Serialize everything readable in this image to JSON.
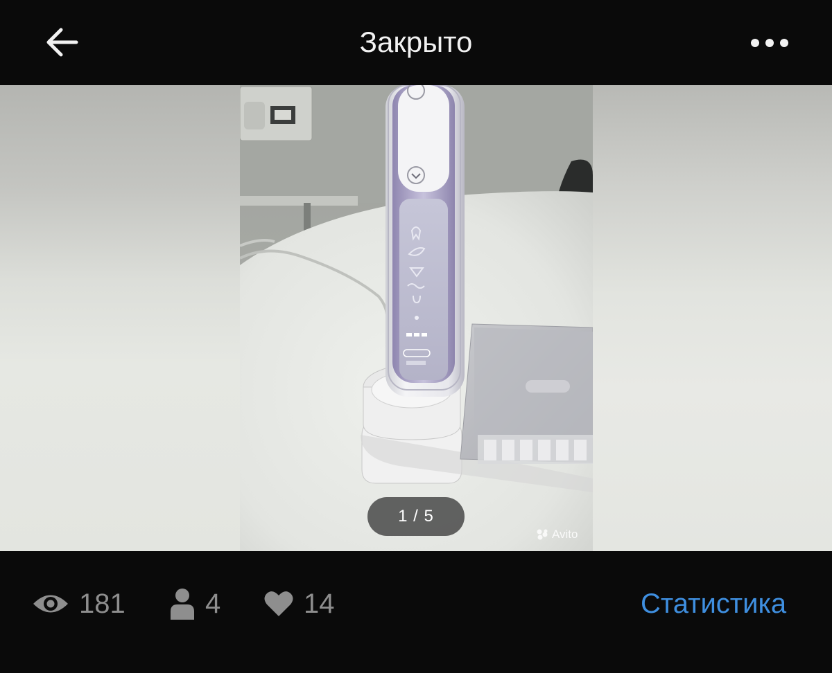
{
  "header": {
    "title": "Закрыто",
    "back_icon": "arrow-left-icon",
    "menu_icon": "more-dots-icon"
  },
  "gallery": {
    "counter": "1 / 5",
    "watermark": "Avito",
    "current_index": 1,
    "total": 5
  },
  "stats": {
    "views": "181",
    "views_icon": "eye-icon",
    "contacts": "4",
    "contacts_icon": "person-icon",
    "favorites": "14",
    "favorites_icon": "heart-icon",
    "link_label": "Статистика"
  },
  "colors": {
    "background": "#0a0a0a",
    "title_text": "#f2f2f2",
    "stat_text": "#8e8e8e",
    "link": "#3f8fe0"
  }
}
